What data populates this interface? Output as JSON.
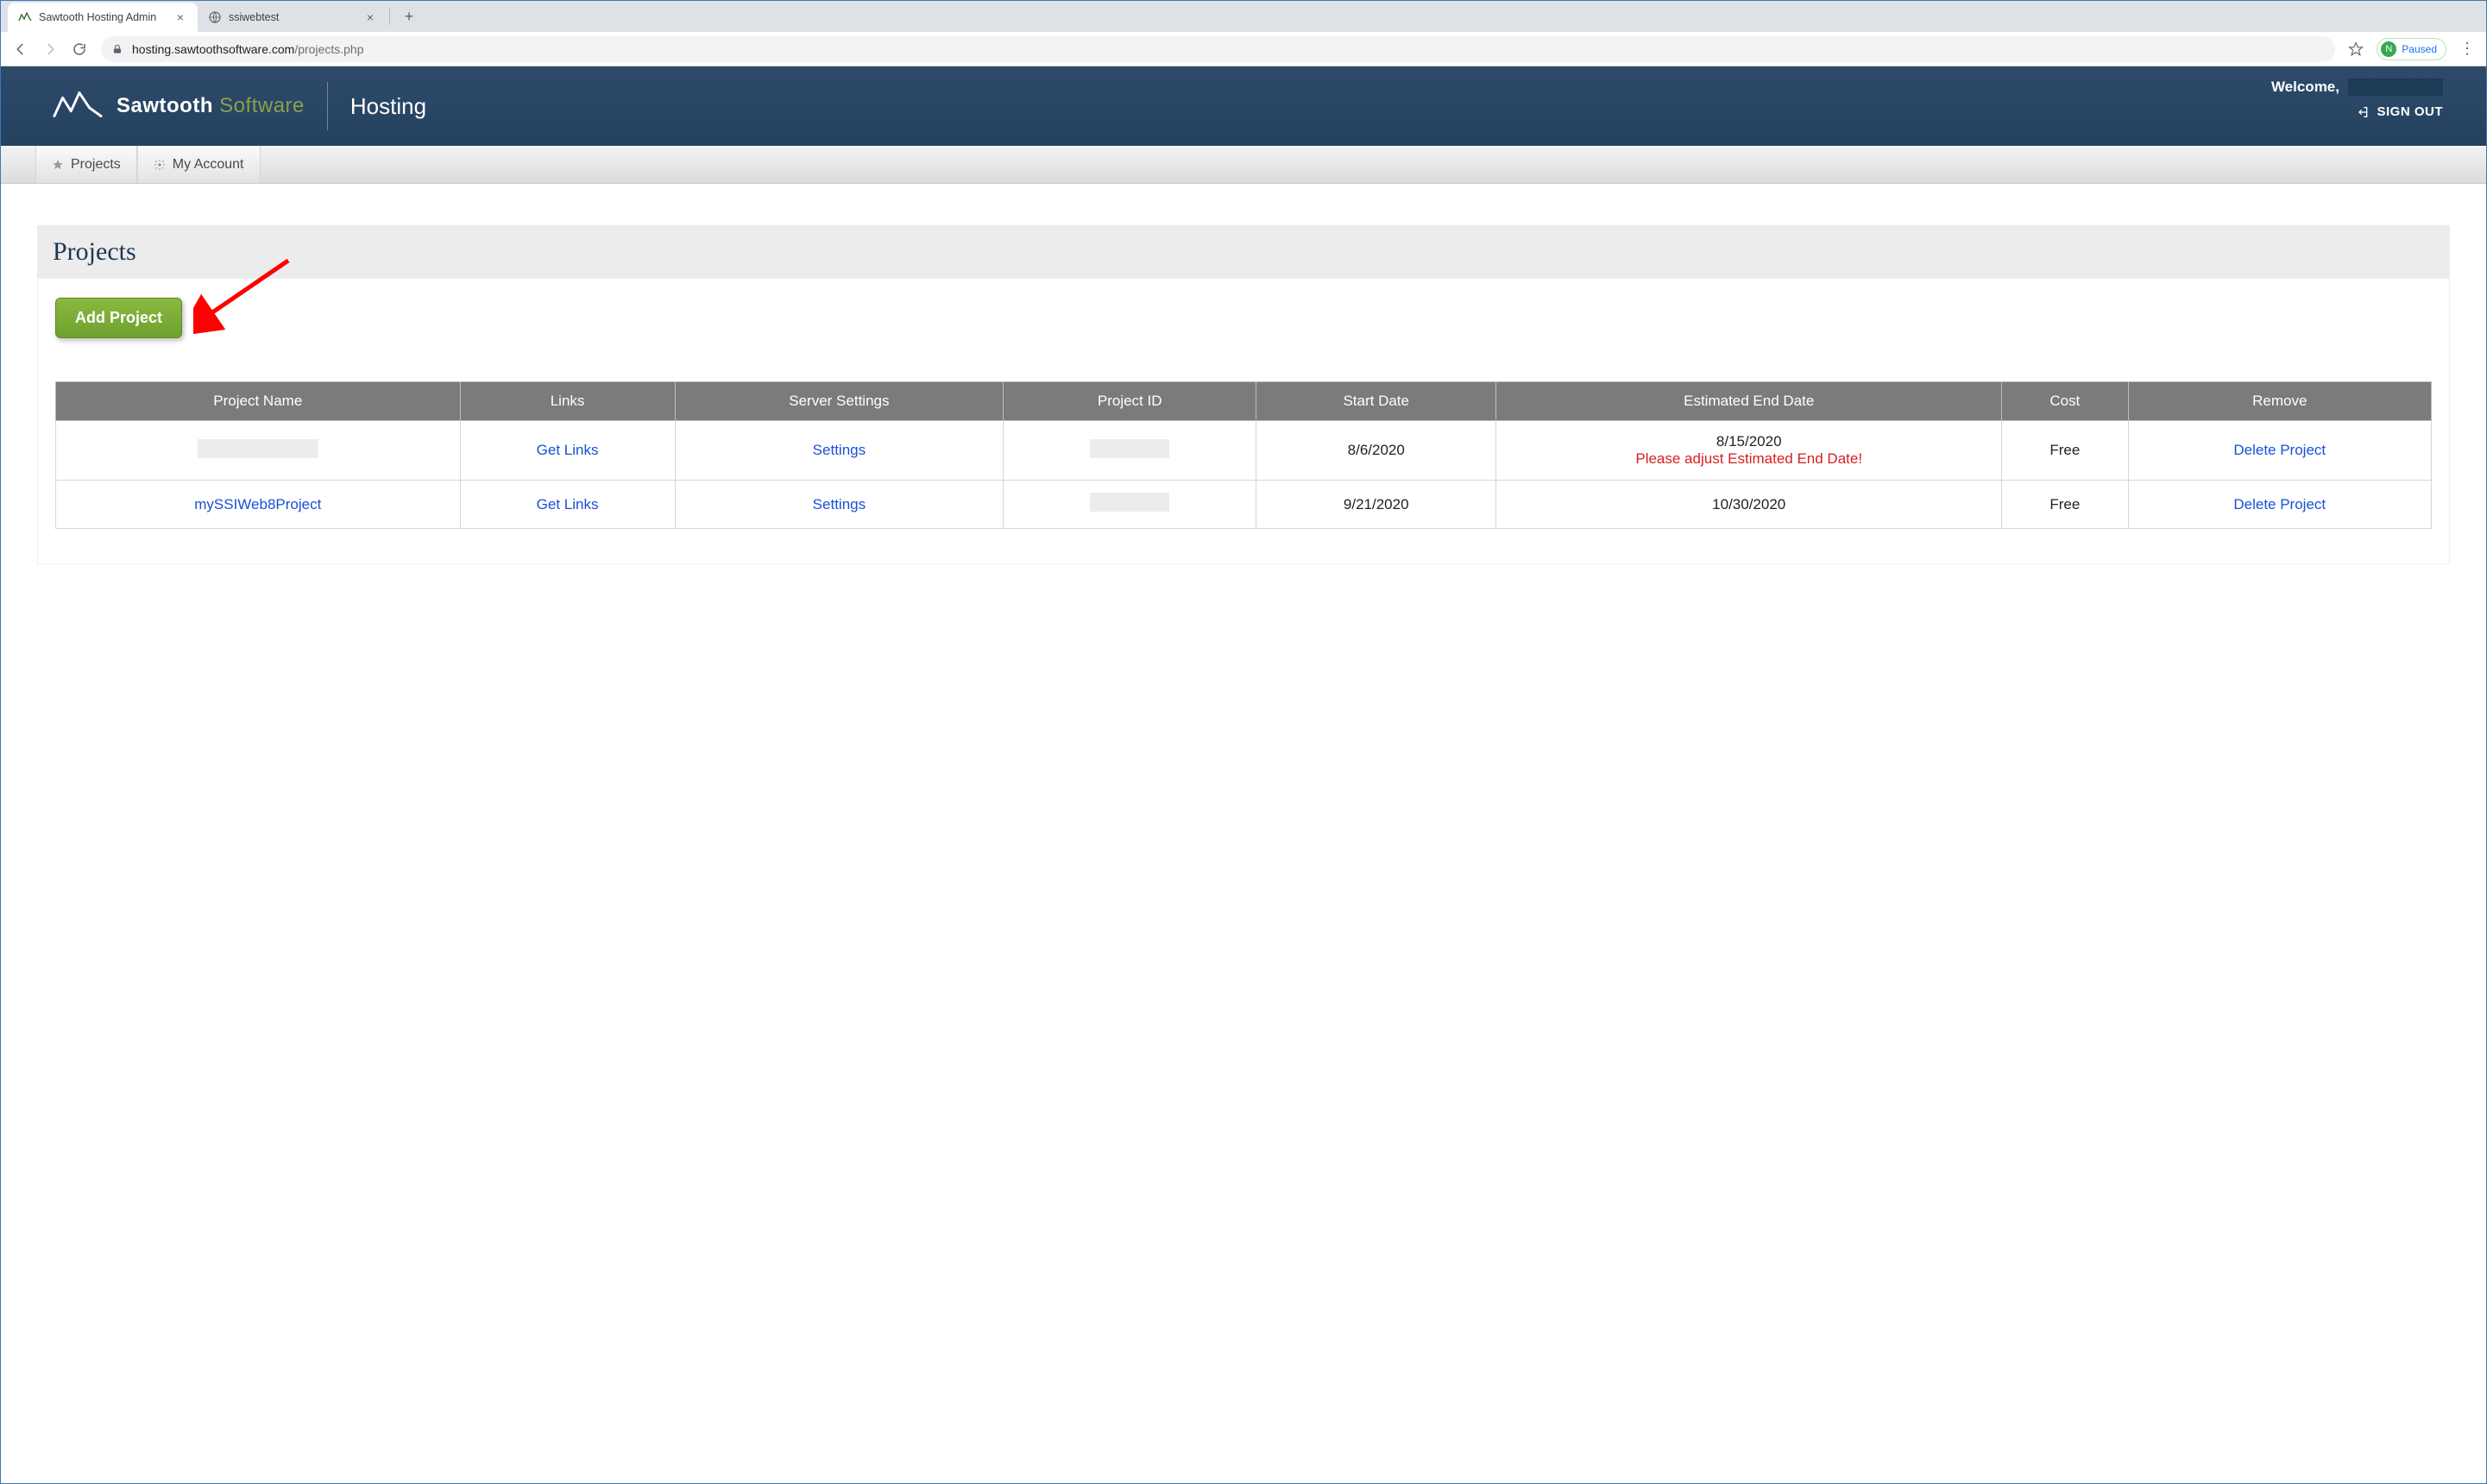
{
  "browser": {
    "tabs": [
      {
        "title": "Sawtooth Hosting Admin",
        "active": true
      },
      {
        "title": "ssiwebtest",
        "active": false
      }
    ],
    "address": {
      "domain": "hosting.sawtoothsoftware.com",
      "path": "/projects.php"
    },
    "profile": {
      "initial": "N",
      "label": "Paused"
    }
  },
  "header": {
    "brand_bold": "Sawtooth",
    "brand_soft": "Software",
    "section": "Hosting",
    "welcome": "Welcome,",
    "signout": "SIGN OUT"
  },
  "nav": {
    "projects": "Projects",
    "account": "My Account"
  },
  "page": {
    "title": "Projects",
    "add_button": "Add Project",
    "columns": {
      "name": "Project Name",
      "links": "Links",
      "settings": "Server Settings",
      "pid": "Project ID",
      "start": "Start Date",
      "end": "Estimated End Date",
      "cost": "Cost",
      "remove": "Remove"
    },
    "link_labels": {
      "get_links": "Get Links",
      "settings": "Settings",
      "delete": "Delete Project"
    },
    "rows": [
      {
        "name": "",
        "name_redacted": true,
        "pid": "",
        "pid_redacted": true,
        "start": "8/6/2020",
        "end": "8/15/2020",
        "end_warning": "Please adjust Estimated End Date!",
        "cost": "Free"
      },
      {
        "name": "mySSIWeb8Project",
        "name_redacted": false,
        "pid": "",
        "pid_redacted": true,
        "start": "9/21/2020",
        "end": "10/30/2020",
        "end_warning": "",
        "cost": "Free"
      }
    ]
  }
}
